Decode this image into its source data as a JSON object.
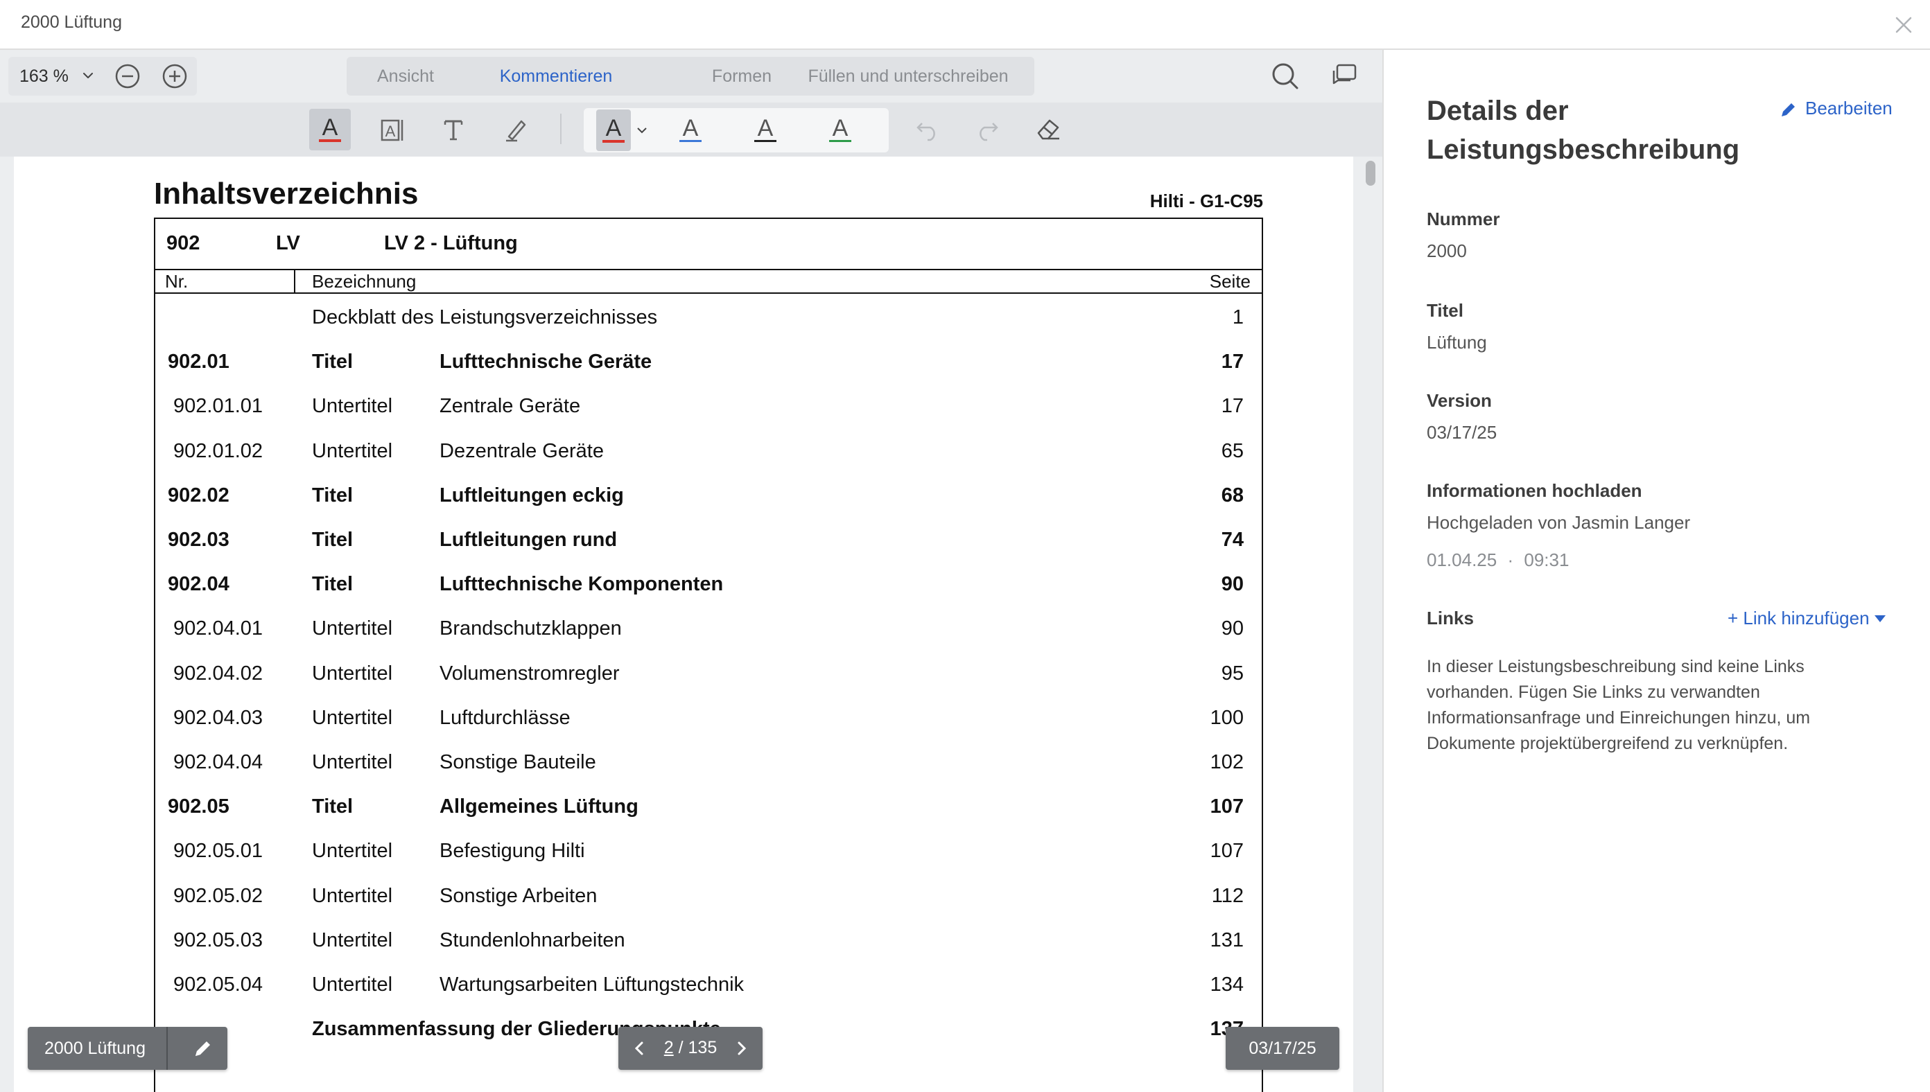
{
  "window": {
    "title": "2000 Lüftung"
  },
  "toolbar": {
    "zoom": "163 %",
    "tabs": [
      {
        "label": "Ansicht",
        "active": false
      },
      {
        "label": "Kommentieren",
        "active": true
      },
      {
        "label": "Formen",
        "active": false
      },
      {
        "label": "Füllen und unterschreiben",
        "active": false
      }
    ],
    "tools": [
      "highlight-text-icon",
      "text-box-icon",
      "text-icon",
      "pen-icon"
    ],
    "color_tools": [
      "text-color-icon",
      "underline-blue-icon",
      "underline-black-icon",
      "underline-green-icon"
    ],
    "colors": {
      "accent": "#2c63c8",
      "highlight_red": "#d9342b",
      "underline_blue": "#3c78d8",
      "underline_black": "#222222",
      "underline_green": "#2e9c4a"
    }
  },
  "document": {
    "heading": "Inhaltsverzeichnis",
    "code": "Hilti - G1-C95",
    "box_head": {
      "number": "902",
      "type": "LV",
      "title": "LV 2 - Lüftung"
    },
    "columns": {
      "nr": "Nr.",
      "name": "Bezeichnung",
      "page": "Seite"
    },
    "rows": [
      {
        "nr": "",
        "type": "",
        "name": "Deckblatt des Leistungsverzeichnisses",
        "page": "1",
        "bold": false,
        "wide": true
      },
      {
        "nr": "902.01",
        "type": "Titel",
        "name": "Lufttechnische Geräte",
        "page": "17",
        "bold": true
      },
      {
        "nr": "902.01.01",
        "type": "Untertitel",
        "name": "Zentrale Geräte",
        "page": "17",
        "bold": false
      },
      {
        "nr": "902.01.02",
        "type": "Untertitel",
        "name": "Dezentrale Geräte",
        "page": "65",
        "bold": false
      },
      {
        "nr": "902.02",
        "type": "Titel",
        "name": "Luftleitungen eckig",
        "page": "68",
        "bold": true
      },
      {
        "nr": "902.03",
        "type": "Titel",
        "name": "Luftleitungen rund",
        "page": "74",
        "bold": true
      },
      {
        "nr": "902.04",
        "type": "Titel",
        "name": "Lufttechnische Komponenten",
        "page": "90",
        "bold": true
      },
      {
        "nr": "902.04.01",
        "type": "Untertitel",
        "name": "Brandschutzklappen",
        "page": "90",
        "bold": false
      },
      {
        "nr": "902.04.02",
        "type": "Untertitel",
        "name": "Volumenstromregler",
        "page": "95",
        "bold": false
      },
      {
        "nr": "902.04.03",
        "type": "Untertitel",
        "name": "Luftdurchlässe",
        "page": "100",
        "bold": false
      },
      {
        "nr": "902.04.04",
        "type": "Untertitel",
        "name": "Sonstige Bauteile",
        "page": "102",
        "bold": false
      },
      {
        "nr": "902.05",
        "type": "Titel",
        "name": "Allgemeines Lüftung",
        "page": "107",
        "bold": true
      },
      {
        "nr": "902.05.01",
        "type": "Untertitel",
        "name": "Befestigung Hilti",
        "page": "107",
        "bold": false
      },
      {
        "nr": "902.05.02",
        "type": "Untertitel",
        "name": "Sonstige Arbeiten",
        "page": "112",
        "bold": false
      },
      {
        "nr": "902.05.03",
        "type": "Untertitel",
        "name": "Stundenlohnarbeiten",
        "page": "131",
        "bold": false
      },
      {
        "nr": "902.05.04",
        "type": "Untertitel",
        "name": "Wartungsarbeiten Lüftungstechnik",
        "page": "134",
        "bold": false
      },
      {
        "nr": "",
        "type": "",
        "name": "Zusammenfassung der Gliederungspunkte",
        "page": "137",
        "bold": true,
        "wide": true
      }
    ]
  },
  "overlay": {
    "name": "2000 Lüftung",
    "page_current": "2",
    "page_total": "/ 135",
    "date": "03/17/25"
  },
  "panel": {
    "title": "Details der Leistungsbeschreibung",
    "edit_label": "Bearbeiten",
    "fields": {
      "nummer_label": "Nummer",
      "nummer_value": "2000",
      "titel_label": "Titel",
      "titel_value": "Lüftung",
      "version_label": "Version",
      "version_value": "03/17/25",
      "upload_label": "Informationen hochladen",
      "upload_by": "Hochgeladen von Jasmin Langer",
      "upload_date": "01.04.25",
      "upload_sep": "·",
      "upload_time": "09:31"
    },
    "links_label": "Links",
    "link_add": "+ Link hinzufügen",
    "links_empty": "In dieser Leistungsbeschreibung sind keine Links vorhanden. Fügen Sie Links zu verwandten Informationsanfrage und Einreichungen hinzu, um Dokumente projektübergreifend zu verknüpfen."
  }
}
